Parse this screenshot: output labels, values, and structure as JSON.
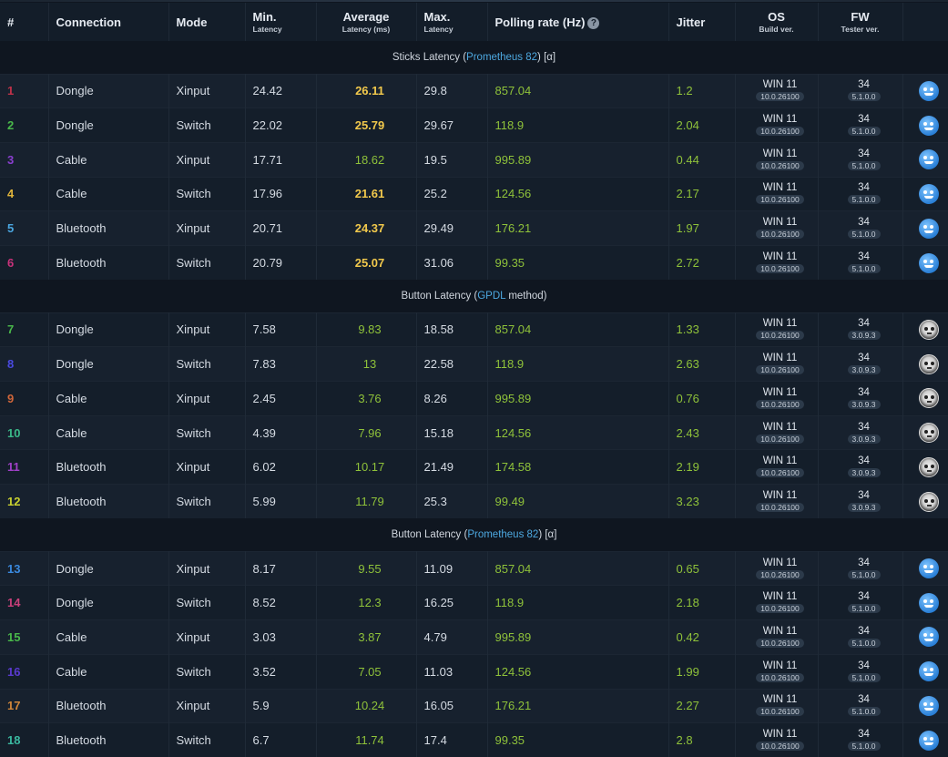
{
  "header": {
    "num": "#",
    "connection": "Connection",
    "mode": "Mode",
    "min": "Min.",
    "min_sub": "Latency",
    "avg": "Average",
    "avg_sub": "Latency (ms)",
    "max": "Max.",
    "max_sub": "Latency",
    "polling": "Polling rate (Hz)",
    "help": "?",
    "jitter": "Jitter",
    "os": "OS",
    "os_sub": "Build ver.",
    "fw": "FW",
    "fw_sub": "Tester ver."
  },
  "sections": [
    {
      "pre": "Sticks Latency (",
      "link": "Prometheus 82",
      "post": ") [α]",
      "icon": "blue-robot-face-icon",
      "rows": [
        {
          "n": "1",
          "nc": "#c0324a",
          "conn": "Dongle",
          "mode": "Xinput",
          "min": "24.42",
          "avg": "26.11",
          "avgc": "yellow",
          "max": "29.8",
          "poll": "857.04",
          "jit": "1.2",
          "os": "WIN 11",
          "build": "10.0.26100",
          "fw": "34",
          "tester": "5.1.0.0"
        },
        {
          "n": "2",
          "nc": "#49b84a",
          "conn": "Dongle",
          "mode": "Switch",
          "min": "22.02",
          "avg": "25.79",
          "avgc": "yellow",
          "max": "29.67",
          "poll": "118.9",
          "jit": "2.04",
          "os": "WIN 11",
          "build": "10.0.26100",
          "fw": "34",
          "tester": "5.1.0.0"
        },
        {
          "n": "3",
          "nc": "#8a3fd0",
          "conn": "Cable",
          "mode": "Xinput",
          "min": "17.71",
          "avg": "18.62",
          "avgc": "green",
          "max": "19.5",
          "poll": "995.89",
          "jit": "0.44",
          "os": "WIN 11",
          "build": "10.0.26100",
          "fw": "34",
          "tester": "5.1.0.0"
        },
        {
          "n": "4",
          "nc": "#e0b43a",
          "conn": "Cable",
          "mode": "Switch",
          "min": "17.96",
          "avg": "21.61",
          "avgc": "yellow",
          "max": "25.2",
          "poll": "124.56",
          "jit": "2.17",
          "os": "WIN 11",
          "build": "10.0.26100",
          "fw": "34",
          "tester": "5.1.0.0"
        },
        {
          "n": "5",
          "nc": "#4aa6e0",
          "conn": "Bluetooth",
          "mode": "Xinput",
          "min": "20.71",
          "avg": "24.37",
          "avgc": "yellow",
          "max": "29.49",
          "poll": "176.21",
          "jit": "1.97",
          "os": "WIN 11",
          "build": "10.0.26100",
          "fw": "34",
          "tester": "5.1.0.0"
        },
        {
          "n": "6",
          "nc": "#c8327a",
          "conn": "Bluetooth",
          "mode": "Switch",
          "min": "20.79",
          "avg": "25.07",
          "avgc": "yellow",
          "max": "31.06",
          "poll": "99.35",
          "jit": "2.72",
          "os": "WIN 11",
          "build": "10.0.26100",
          "fw": "34",
          "tester": "5.1.0.0"
        }
      ]
    },
    {
      "pre": "Button Latency (",
      "link": "GPDL",
      "post": " method)",
      "icon": "skull-avatar-icon",
      "rows": [
        {
          "n": "7",
          "nc": "#49b84a",
          "conn": "Dongle",
          "mode": "Xinput",
          "min": "7.58",
          "avg": "9.83",
          "avgc": "green",
          "max": "18.58",
          "poll": "857.04",
          "jit": "1.33",
          "os": "WIN 11",
          "build": "10.0.26100",
          "fw": "34",
          "tester": "3.0.9.3"
        },
        {
          "n": "8",
          "nc": "#4a4ae0",
          "conn": "Dongle",
          "mode": "Switch",
          "min": "7.83",
          "avg": "13",
          "avgc": "green",
          "max": "22.58",
          "poll": "118.9",
          "jit": "2.63",
          "os": "WIN 11",
          "build": "10.0.26100",
          "fw": "34",
          "tester": "3.0.9.3"
        },
        {
          "n": "9",
          "nc": "#d0663a",
          "conn": "Cable",
          "mode": "Xinput",
          "min": "2.45",
          "avg": "3.76",
          "avgc": "green",
          "max": "8.26",
          "poll": "995.89",
          "jit": "0.76",
          "os": "WIN 11",
          "build": "10.0.26100",
          "fw": "34",
          "tester": "3.0.9.3"
        },
        {
          "n": "10",
          "nc": "#3ab888",
          "conn": "Cable",
          "mode": "Switch",
          "min": "4.39",
          "avg": "7.96",
          "avgc": "green",
          "max": "15.18",
          "poll": "124.56",
          "jit": "2.43",
          "os": "WIN 11",
          "build": "10.0.26100",
          "fw": "34",
          "tester": "3.0.9.3"
        },
        {
          "n": "11",
          "nc": "#a040c8",
          "conn": "Bluetooth",
          "mode": "Xinput",
          "min": "6.02",
          "avg": "10.17",
          "avgc": "green",
          "max": "21.49",
          "poll": "174.58",
          "jit": "2.19",
          "os": "WIN 11",
          "build": "10.0.26100",
          "fw": "34",
          "tester": "3.0.9.3"
        },
        {
          "n": "12",
          "nc": "#c8d030",
          "conn": "Bluetooth",
          "mode": "Switch",
          "min": "5.99",
          "avg": "11.79",
          "avgc": "green",
          "max": "25.3",
          "poll": "99.49",
          "jit": "3.23",
          "os": "WIN 11",
          "build": "10.0.26100",
          "fw": "34",
          "tester": "3.0.9.3"
        }
      ]
    },
    {
      "pre": "Button Latency (",
      "link": "Prometheus 82",
      "post": ") [α]",
      "icon": "blue-robot-face-icon",
      "rows": [
        {
          "n": "13",
          "nc": "#3a8ae0",
          "conn": "Dongle",
          "mode": "Xinput",
          "min": "8.17",
          "avg": "9.55",
          "avgc": "green",
          "max": "11.09",
          "poll": "857.04",
          "jit": "0.65",
          "os": "WIN 11",
          "build": "10.0.26100",
          "fw": "34",
          "tester": "5.1.0.0"
        },
        {
          "n": "14",
          "nc": "#c8407a",
          "conn": "Dongle",
          "mode": "Switch",
          "min": "8.52",
          "avg": "12.3",
          "avgc": "green",
          "max": "16.25",
          "poll": "118.9",
          "jit": "2.18",
          "os": "WIN 11",
          "build": "10.0.26100",
          "fw": "34",
          "tester": "5.1.0.0"
        },
        {
          "n": "15",
          "nc": "#49b84a",
          "conn": "Cable",
          "mode": "Xinput",
          "min": "3.03",
          "avg": "3.87",
          "avgc": "green",
          "max": "4.79",
          "poll": "995.89",
          "jit": "0.42",
          "os": "WIN 11",
          "build": "10.0.26100",
          "fw": "34",
          "tester": "5.1.0.0"
        },
        {
          "n": "16",
          "nc": "#5a3ad0",
          "conn": "Cable",
          "mode": "Switch",
          "min": "3.52",
          "avg": "7.05",
          "avgc": "green",
          "max": "11.03",
          "poll": "124.56",
          "jit": "1.99",
          "os": "WIN 11",
          "build": "10.0.26100",
          "fw": "34",
          "tester": "5.1.0.0"
        },
        {
          "n": "17",
          "nc": "#d0863a",
          "conn": "Bluetooth",
          "mode": "Xinput",
          "min": "5.9",
          "avg": "10.24",
          "avgc": "green",
          "max": "16.05",
          "poll": "176.21",
          "jit": "2.27",
          "os": "WIN 11",
          "build": "10.0.26100",
          "fw": "34",
          "tester": "5.1.0.0"
        },
        {
          "n": "18",
          "nc": "#3ab8a0",
          "conn": "Bluetooth",
          "mode": "Switch",
          "min": "6.7",
          "avg": "11.74",
          "avgc": "green",
          "max": "17.4",
          "poll": "99.35",
          "jit": "2.8",
          "os": "WIN 11",
          "build": "10.0.26100",
          "fw": "34",
          "tester": "5.1.0.0"
        }
      ]
    }
  ]
}
